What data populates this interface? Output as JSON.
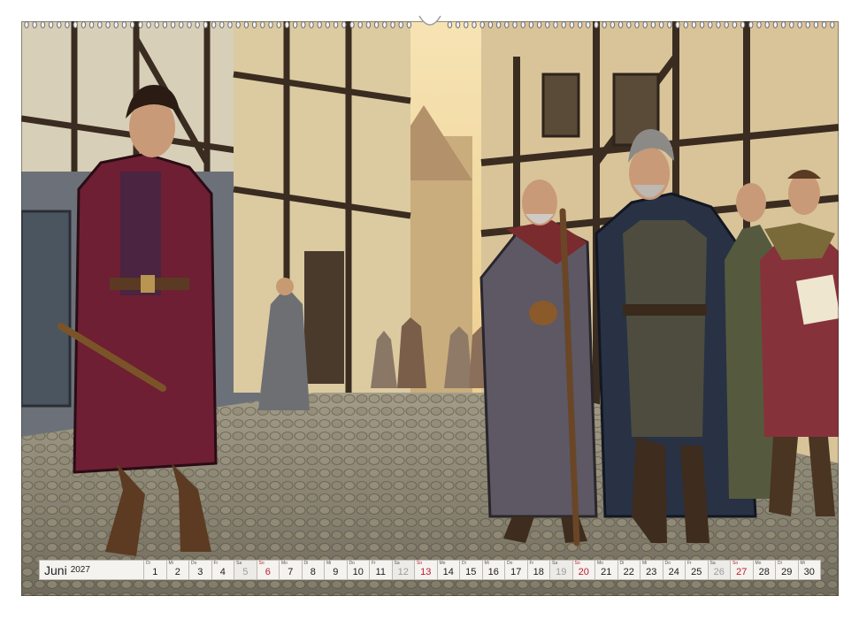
{
  "calendar": {
    "month": "Juni",
    "year": "2027",
    "days": [
      {
        "wd": "Di",
        "d": "1",
        "type": "normal"
      },
      {
        "wd": "Mi",
        "d": "2",
        "type": "normal"
      },
      {
        "wd": "Do",
        "d": "3",
        "type": "normal"
      },
      {
        "wd": "Fr",
        "d": "4",
        "type": "normal"
      },
      {
        "wd": "Sa",
        "d": "5",
        "type": "muted"
      },
      {
        "wd": "So",
        "d": "6",
        "type": "sun"
      },
      {
        "wd": "Mo",
        "d": "7",
        "type": "normal"
      },
      {
        "wd": "Di",
        "d": "8",
        "type": "normal"
      },
      {
        "wd": "Mi",
        "d": "9",
        "type": "normal"
      },
      {
        "wd": "Do",
        "d": "10",
        "type": "normal"
      },
      {
        "wd": "Fr",
        "d": "11",
        "type": "normal"
      },
      {
        "wd": "Sa",
        "d": "12",
        "type": "muted"
      },
      {
        "wd": "So",
        "d": "13",
        "type": "sun"
      },
      {
        "wd": "Mo",
        "d": "14",
        "type": "normal"
      },
      {
        "wd": "Di",
        "d": "15",
        "type": "normal"
      },
      {
        "wd": "Mi",
        "d": "16",
        "type": "normal"
      },
      {
        "wd": "Do",
        "d": "17",
        "type": "normal"
      },
      {
        "wd": "Fr",
        "d": "18",
        "type": "normal"
      },
      {
        "wd": "Sa",
        "d": "19",
        "type": "muted"
      },
      {
        "wd": "So",
        "d": "20",
        "type": "sun"
      },
      {
        "wd": "Mo",
        "d": "21",
        "type": "normal"
      },
      {
        "wd": "Di",
        "d": "22",
        "type": "normal"
      },
      {
        "wd": "Mi",
        "d": "23",
        "type": "normal"
      },
      {
        "wd": "Do",
        "d": "24",
        "type": "normal"
      },
      {
        "wd": "Fr",
        "d": "25",
        "type": "normal"
      },
      {
        "wd": "Sa",
        "d": "26",
        "type": "muted"
      },
      {
        "wd": "So",
        "d": "27",
        "type": "sun"
      },
      {
        "wd": "Mo",
        "d": "28",
        "type": "normal"
      },
      {
        "wd": "Di",
        "d": "29",
        "type": "normal"
      },
      {
        "wd": "Mi",
        "d": "30",
        "type": "normal"
      }
    ]
  },
  "colors": {
    "sunday": "#c0192c",
    "sky": "#f3d89a",
    "cobble": "#8c8878"
  }
}
